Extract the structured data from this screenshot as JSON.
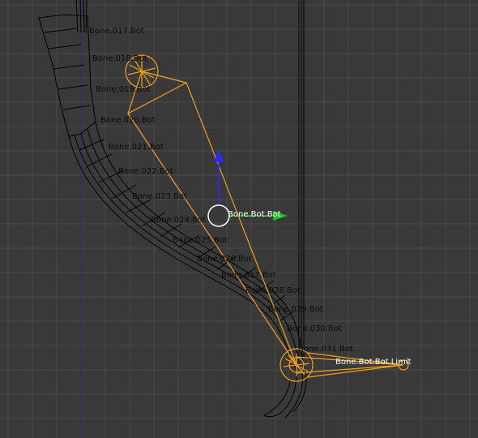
{
  "viewport": {
    "background": "#393939",
    "grid_color": "#4a4a4a",
    "wire_color": "#000000",
    "bone_color": "#f0a020",
    "active_label_color": "#ffffff",
    "label_color": "#0a0a0a"
  },
  "bone_labels": [
    "Bone.017.Bot",
    "Bone.018.Bot",
    "Bone.019.Bot",
    "Bone.020.Bot",
    "Bone.021.Bot",
    "Bone.022.Bot",
    "Bone.023.Bot",
    "Bone.024.Bot",
    "Bone.025.Bot",
    "Bone.026.Bot",
    "Bone.027.Bot",
    "Bone.028.Bot",
    "Bone.029.Bot",
    "Bone.030.Bot",
    "Bone.031.Bot"
  ],
  "active_bone_label": "Bone.Bot.Bot",
  "limit_bone_label": "Bone.Bot.Bot.Limit",
  "gizmo": {
    "y_axis_color": "#2a2aff",
    "x_axis_color": "#20c020",
    "center_color": "#ffffff"
  }
}
